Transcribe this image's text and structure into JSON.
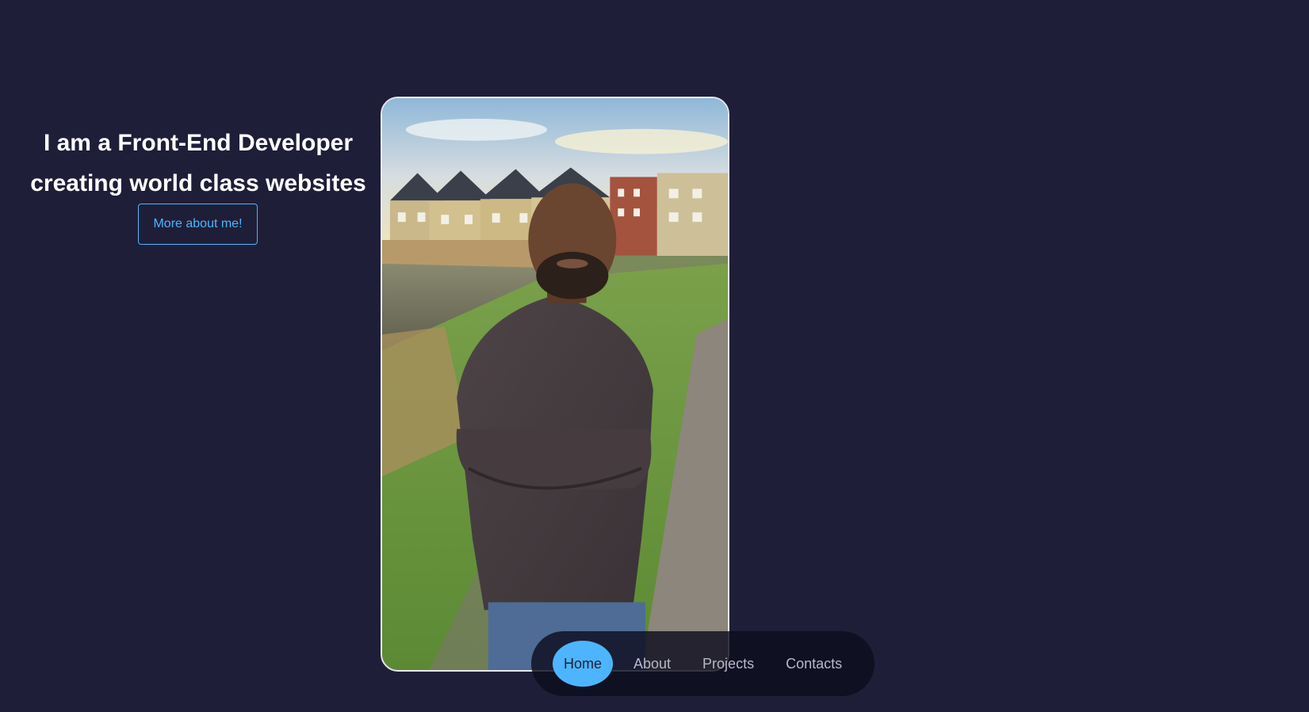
{
  "hero": {
    "title_line1": "I am a Front-End Developer",
    "title_line2": "creating world class websites",
    "cta_label": "More about me!"
  },
  "portrait": {
    "alt": "Portrait photo"
  },
  "nav": {
    "items": [
      {
        "label": "Home",
        "active": true
      },
      {
        "label": "About",
        "active": false
      },
      {
        "label": "Projects",
        "active": false
      },
      {
        "label": "Contacts",
        "active": false
      }
    ]
  },
  "colors": {
    "background": "#1f1e38",
    "accent": "#4db5ff",
    "text": "#ffffff",
    "nav_bg": "#0e0e1e"
  }
}
